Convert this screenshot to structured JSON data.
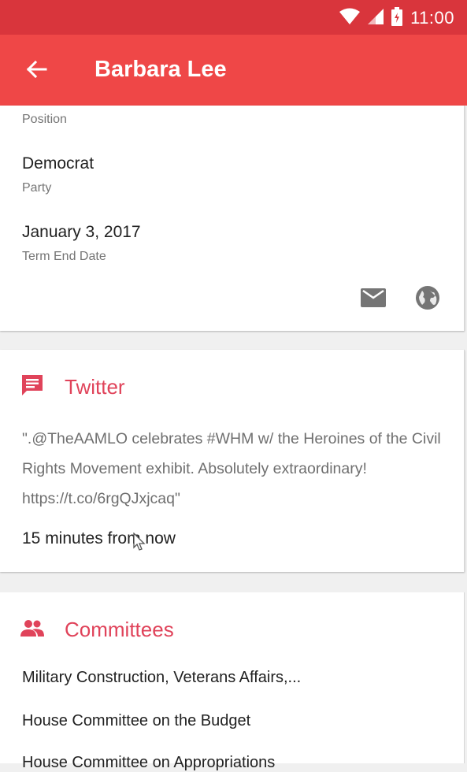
{
  "status_bar": {
    "time": "11:00"
  },
  "app_bar": {
    "title": "Barbara Lee"
  },
  "details": {
    "position_label": "Position",
    "party_value": "Democrat",
    "party_label": "Party",
    "term_end_value": "January 3, 2017",
    "term_end_label": "Term End Date"
  },
  "twitter": {
    "title": "Twitter",
    "tweet": "\".@TheAAMLO celebrates #WHM w/ the Heroines of the Civil Rights Movement exhibit. Absolutely extraordinary! https://t.co/6rgQJxjcaq\"",
    "time": "15 minutes from now"
  },
  "committees": {
    "title": "Committees",
    "items": [
      "Military Construction, Veterans Affairs,...",
      "House Committee on the Budget",
      "House Committee on Appropriations"
    ]
  },
  "colors": {
    "status_bar": "#d9353c",
    "app_bar": "#ef4747",
    "accent": "#e0435a"
  }
}
